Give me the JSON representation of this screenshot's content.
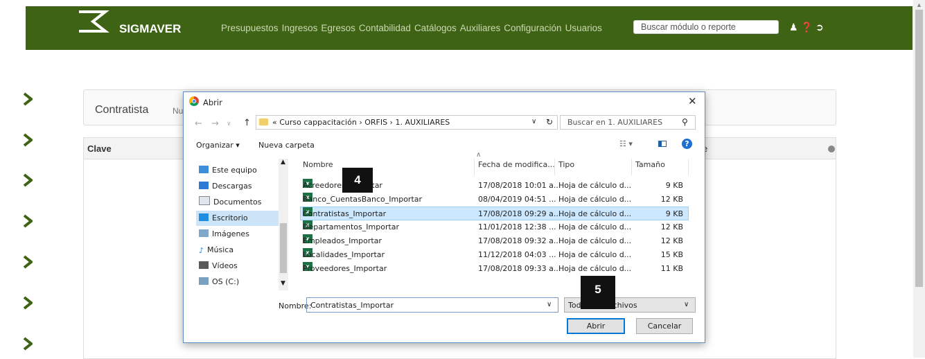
{
  "app": {
    "brand": "SIGMAVER",
    "nav": [
      "Presupuestos",
      "Ingresos",
      "Egresos",
      "Contabilidad",
      "Catálogos",
      "Auxiliares",
      "Configuración",
      "Usuarios"
    ],
    "search_placeholder": "Buscar módulo o reporte",
    "accent_color": "#3e6314"
  },
  "page": {
    "title": "Contratista",
    "subtitle": "Nu",
    "grid_column_first": "Clave",
    "grid_column_last": "e"
  },
  "dialog": {
    "title": "Abrir",
    "close": "✕",
    "breadcrumb": "« Curso cappacitación › ORFIS › 1. AUXILIARES",
    "search_placeholder": "Buscar en 1. AUXILIARES",
    "organize": "Organizar ▾",
    "new_folder": "Nueva carpeta",
    "help": "?",
    "nav_items": [
      "Este equipo",
      "Descargas",
      "Documentos",
      "Escritorio",
      "Imágenes",
      "Música",
      "Vídeos",
      "OS (C:)"
    ],
    "columns": [
      "Nombre",
      "Fecha de modifica...",
      "Tipo",
      "Tamaño"
    ],
    "files": [
      {
        "name": "Acreedores_Importar",
        "date": "17/08/2018 10:01 a...",
        "type": "Hoja de cálculo d...",
        "size": "9 KB"
      },
      {
        "name": "Banco_CuentasBanco_Importar",
        "date": "08/04/2019 04:51 ...",
        "type": "Hoja de cálculo d...",
        "size": "12 KB"
      },
      {
        "name": "Contratistas_Importar",
        "date": "17/08/2018 09:29 a...",
        "type": "Hoja de cálculo d...",
        "size": "9 KB"
      },
      {
        "name": "Departamentos_Importar",
        "date": "11/01/2018 12:38 ...",
        "type": "Hoja de cálculo d...",
        "size": "12 KB"
      },
      {
        "name": "Empleados_Importar",
        "date": "17/08/2018 09:32 a...",
        "type": "Hoja de cálculo d...",
        "size": "12 KB"
      },
      {
        "name": "Localidades_Importar",
        "date": "11/12/2018 04:03 ...",
        "type": "Hoja de cálculo d...",
        "size": "15 KB"
      },
      {
        "name": "Proveedores_Importar",
        "date": "17/08/2018 09:33 a...",
        "type": "Hoja de cálculo d...",
        "size": "11 KB"
      }
    ],
    "selected_file_index": 2,
    "selected_nav_index": 3,
    "filename_label": "Nombre:",
    "filename_value": "Contratistas_Importar",
    "filetype_value": "Todos los archivos",
    "open_button": "Abrir",
    "cancel_button": "Cancelar"
  },
  "callouts": [
    "4",
    "5"
  ]
}
